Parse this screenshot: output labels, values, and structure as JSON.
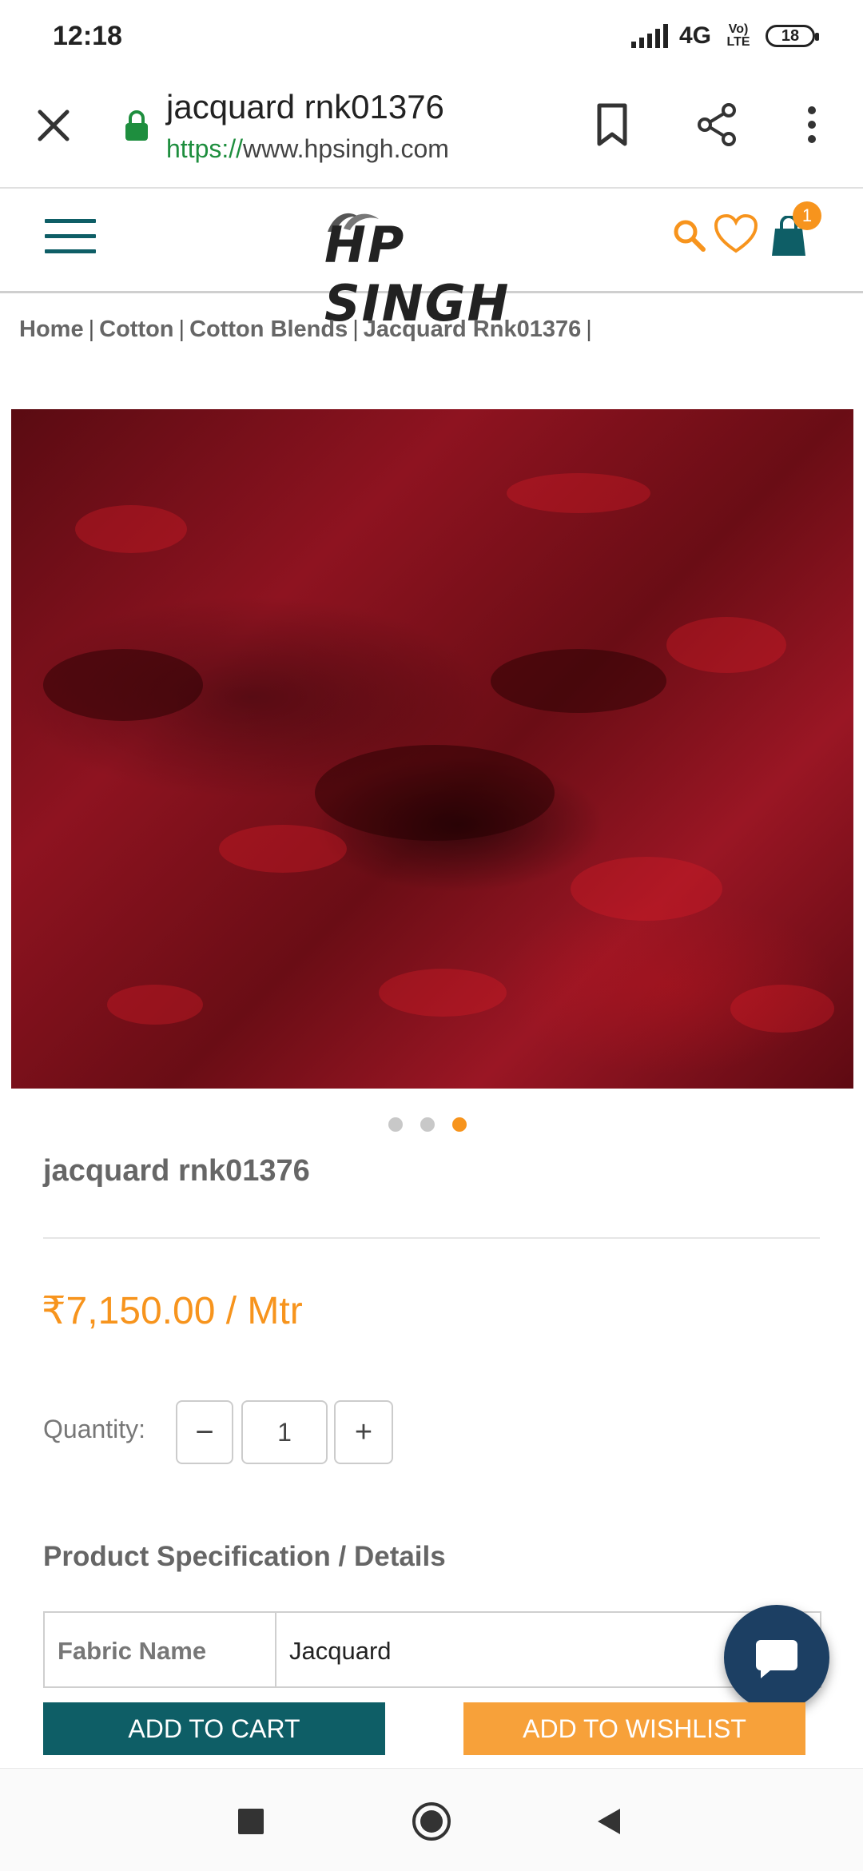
{
  "status_bar": {
    "time": "12:18",
    "network": "4G",
    "volte": "Vo) LTE",
    "battery": "18"
  },
  "browser": {
    "page_title": "jacquard rnk01376",
    "url_scheme": "https://",
    "url_host": "www.hpsingh.com",
    "lock_color": "#1e8e3e"
  },
  "site_header": {
    "logo_text": "HP SINGH",
    "cart_count": "1",
    "icons": [
      "menu-icon",
      "search-icon",
      "heart-icon",
      "shopping-bag-icon"
    ],
    "accent_color": "#f7941d",
    "brand_color": "#0e5e66"
  },
  "breadcrumb": {
    "items": [
      "Home",
      "Cotton",
      "Cotton Blends",
      "Jacquard Rnk01376"
    ],
    "separator": "|"
  },
  "carousel": {
    "total": 3,
    "active_index": 2
  },
  "product": {
    "title": "jacquard rnk01376",
    "price": "₹7,150.00 / Mtr",
    "quantity_label": "Quantity:",
    "quantity_value": "1",
    "minus_label": "−",
    "plus_label": "+",
    "spec_heading": "Product Specification / Details",
    "specs": [
      {
        "key": "Fabric Name",
        "value": "Jacquard"
      }
    ]
  },
  "actions": {
    "add_to_cart": "ADD TO CART",
    "add_to_wishlist": "ADD TO WISHLIST"
  }
}
